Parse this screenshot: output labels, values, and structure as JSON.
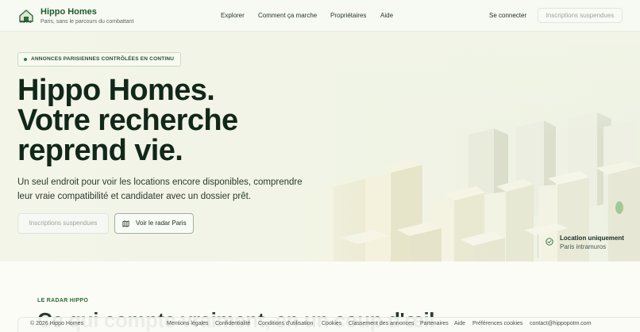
{
  "header": {
    "logo_caption": "HIPPO",
    "brand_name": "Hippo Homes",
    "brand_tagline": "Paris, sans le parcours du combattant",
    "nav": [
      "Explorer",
      "Comment ça marche",
      "Propriétaires",
      "Aide"
    ],
    "login": "Se connecter",
    "signup_disabled": "Inscriptions suspendues"
  },
  "hero": {
    "badge": "ANNONCES PARISIENNES CONTRÔLÉES EN CONTINU",
    "headline": [
      "Hippo Homes.",
      "Votre recherche",
      "reprend vie."
    ],
    "lead": "Un seul endroit pour voir les locations encore disponibles, comprendre leur vraie compatibilité et candidater avec un dossier prêt.",
    "btn_disabled": "Inscriptions suspendues",
    "btn_radar": "Voir le radar Paris",
    "location_title": "Location uniquement",
    "location_sub": "Paris intramuros"
  },
  "section": {
    "label": "LE RADAR HIPPO",
    "title": "Ce qui compte vraiment, en un coup d'œil"
  },
  "footer": {
    "copyright": "© 2026 Hippo Homes",
    "links": [
      "Mentions légales",
      "Confidentialité",
      "Conditions d'utilisation",
      "Cookies",
      "Classement des annonces",
      "Partenaires",
      "Aide",
      "Préférences cookies",
      "contact@hippopotm.com"
    ]
  },
  "colors": {
    "brand_green": "#1f5a2e",
    "heading": "#11271a",
    "hero_bg": "#f1f4e6"
  }
}
